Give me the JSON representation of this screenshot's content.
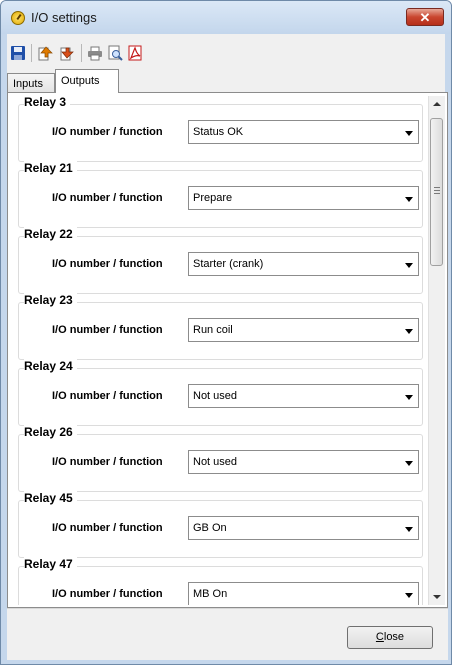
{
  "window": {
    "title": "I/O settings",
    "close_glyph": "✕"
  },
  "toolbar": {
    "icons": [
      "save-icon",
      "import-icon",
      "export-icon",
      "print-icon",
      "print-preview-icon",
      "pdf-icon"
    ]
  },
  "tabs": [
    {
      "label": "Inputs",
      "active": false
    },
    {
      "label": "Outputs",
      "active": true
    }
  ],
  "relays": [
    {
      "title": "Relay 3",
      "field_label": "I/O number / function",
      "value": "Status OK"
    },
    {
      "title": "Relay 21",
      "field_label": "I/O number / function",
      "value": "Prepare"
    },
    {
      "title": "Relay 22",
      "field_label": "I/O number / function",
      "value": "Starter (crank)"
    },
    {
      "title": "Relay 23",
      "field_label": "I/O number / function",
      "value": "Run coil"
    },
    {
      "title": "Relay 24",
      "field_label": "I/O number / function",
      "value": "Not used"
    },
    {
      "title": "Relay 26",
      "field_label": "I/O number / function",
      "value": "Not used"
    },
    {
      "title": "Relay 45",
      "field_label": "I/O number / function",
      "value": "GB On"
    },
    {
      "title": "Relay 47",
      "field_label": "I/O number / function",
      "value": "MB On"
    }
  ],
  "footer": {
    "close_mnemonic": "C",
    "close_rest": "lose"
  },
  "colors": {
    "titlebar": "#c3d6ec",
    "close_button": "#c9452f",
    "panel": "#f0f0f0"
  }
}
